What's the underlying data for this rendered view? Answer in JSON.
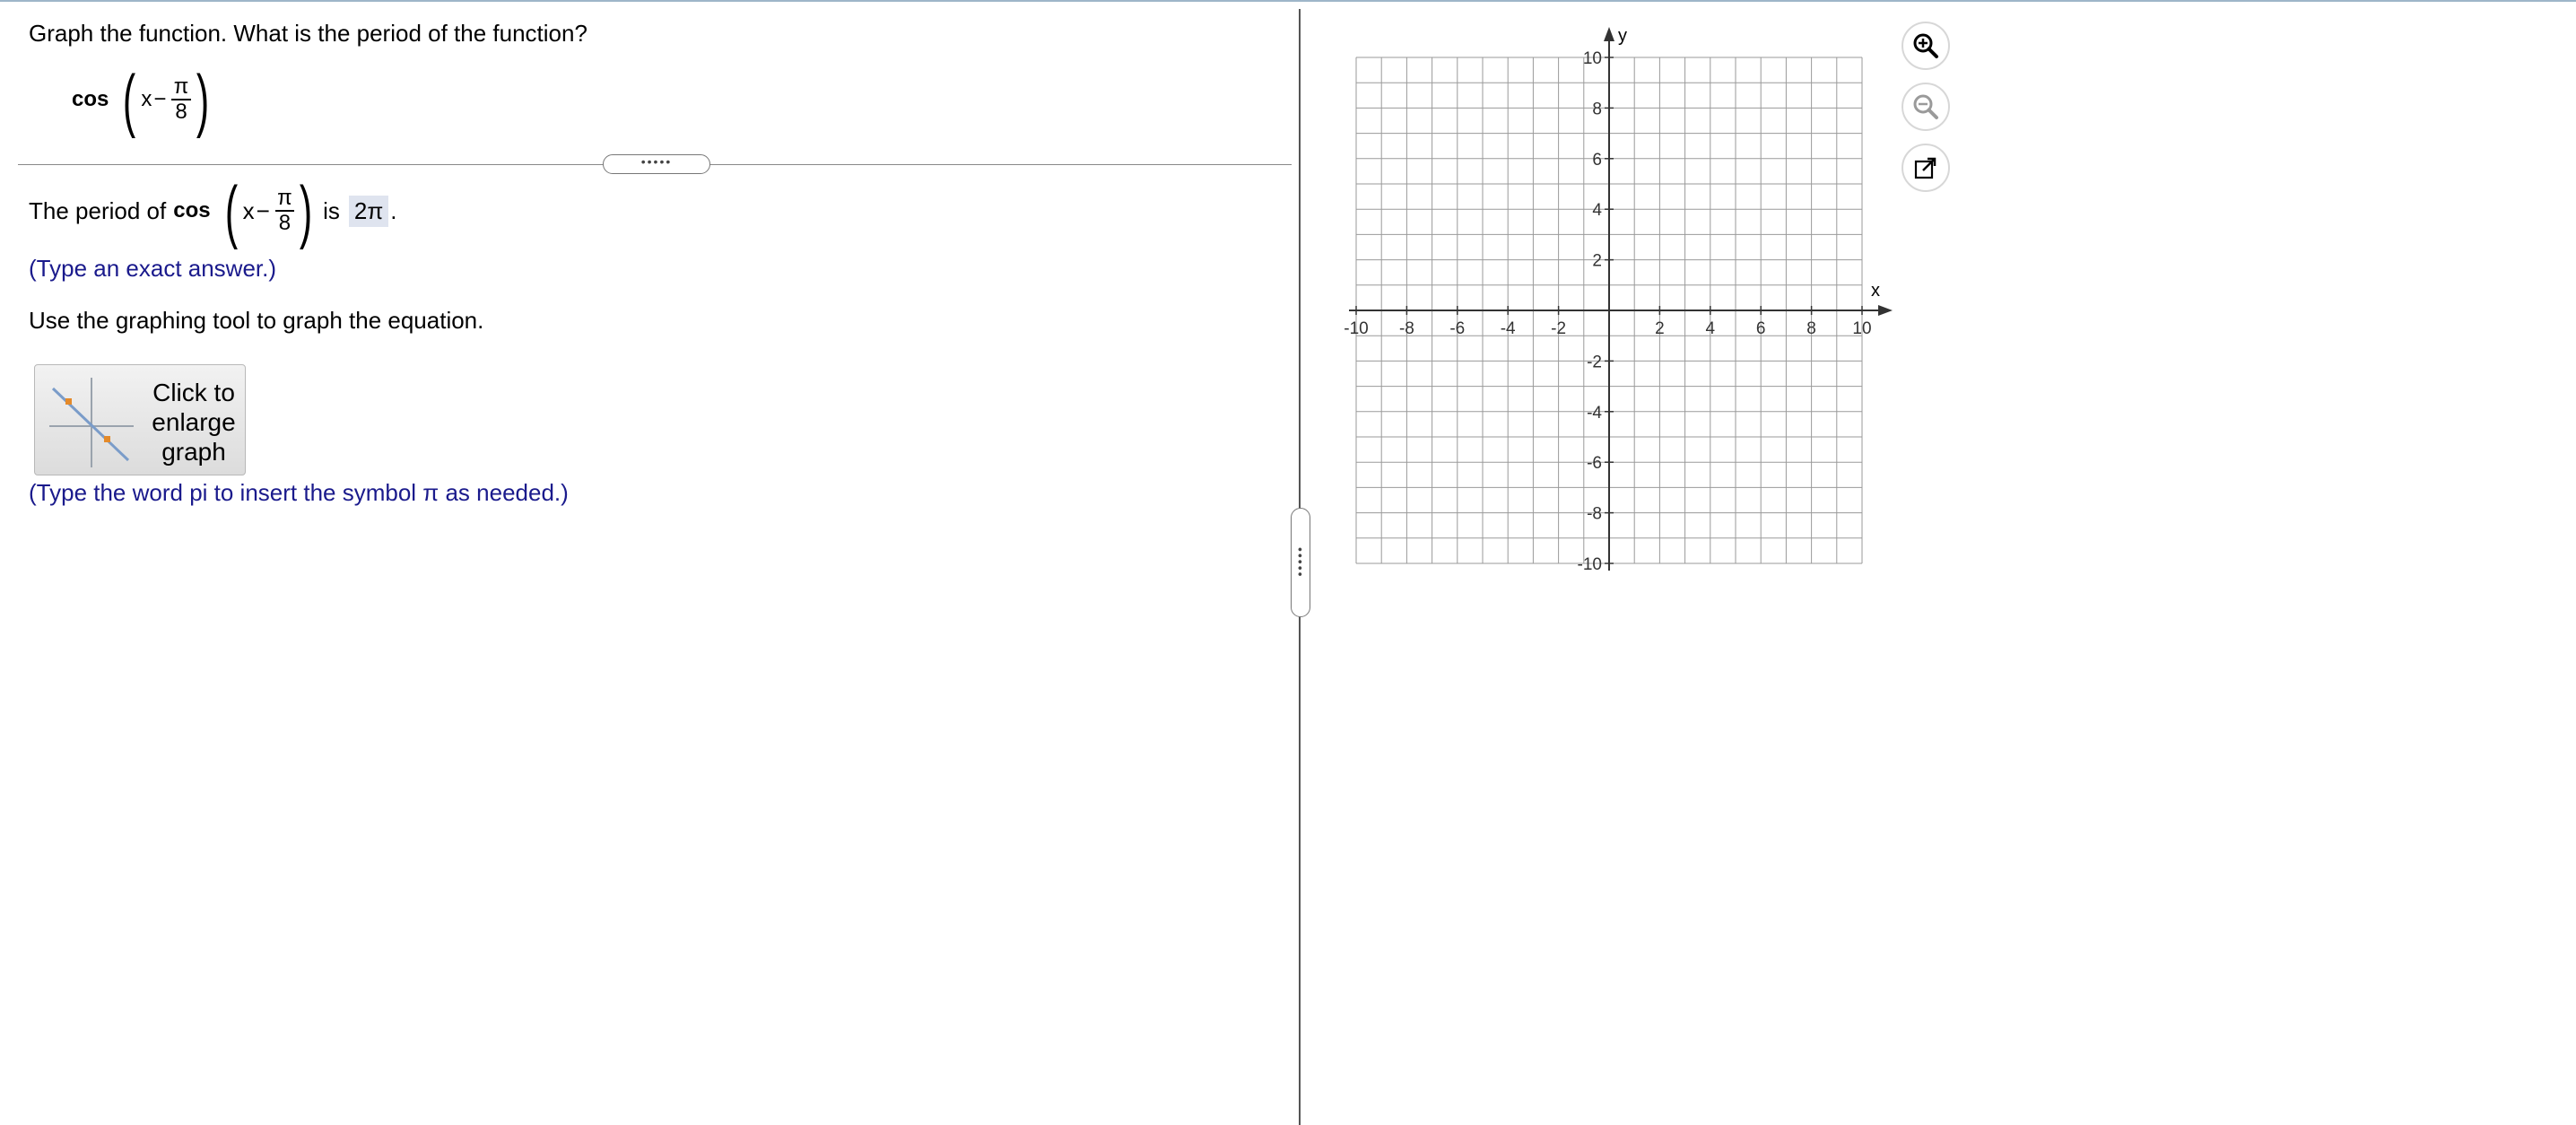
{
  "question": {
    "prompt": "Graph the function. What is the period of the function?",
    "function": {
      "name": "cos",
      "var": "x",
      "minus": "−",
      "num": "π",
      "den": "8"
    }
  },
  "answer": {
    "prefix": "The period of",
    "fn_name": "cos",
    "var": "x",
    "minus": "−",
    "num": "π",
    "den": "8",
    "is_text": "is",
    "value": "2π",
    "suffix": ".",
    "hint": "(Type an exact answer.)"
  },
  "instructions": {
    "graph_tool": "Use the graphing tool to graph the equation.",
    "pi_hint": "(Type the word pi to insert the symbol π as needed.)"
  },
  "enlarge_button": {
    "label": "Click to enlarge graph"
  },
  "splitters": {
    "horizontal_label": "•••••",
    "vertical_label": "•••••"
  },
  "graph": {
    "x_label": "x",
    "y_label": "y",
    "x_range": [
      -10,
      10
    ],
    "y_range": [
      -10,
      10
    ],
    "grid_step": 1,
    "tick_labels": [
      -10,
      -8,
      -6,
      -4,
      -2,
      2,
      4,
      6,
      8,
      10
    ],
    "grid": true
  },
  "tools": {
    "zoom_in": "zoom-in-icon",
    "zoom_out": "zoom-out-icon",
    "pop_out": "pop-out-icon"
  },
  "colors": {
    "instruction_blue": "#1a1a8c",
    "answer_bg": "#dfe4ef",
    "grid": "#9a9a9a"
  }
}
